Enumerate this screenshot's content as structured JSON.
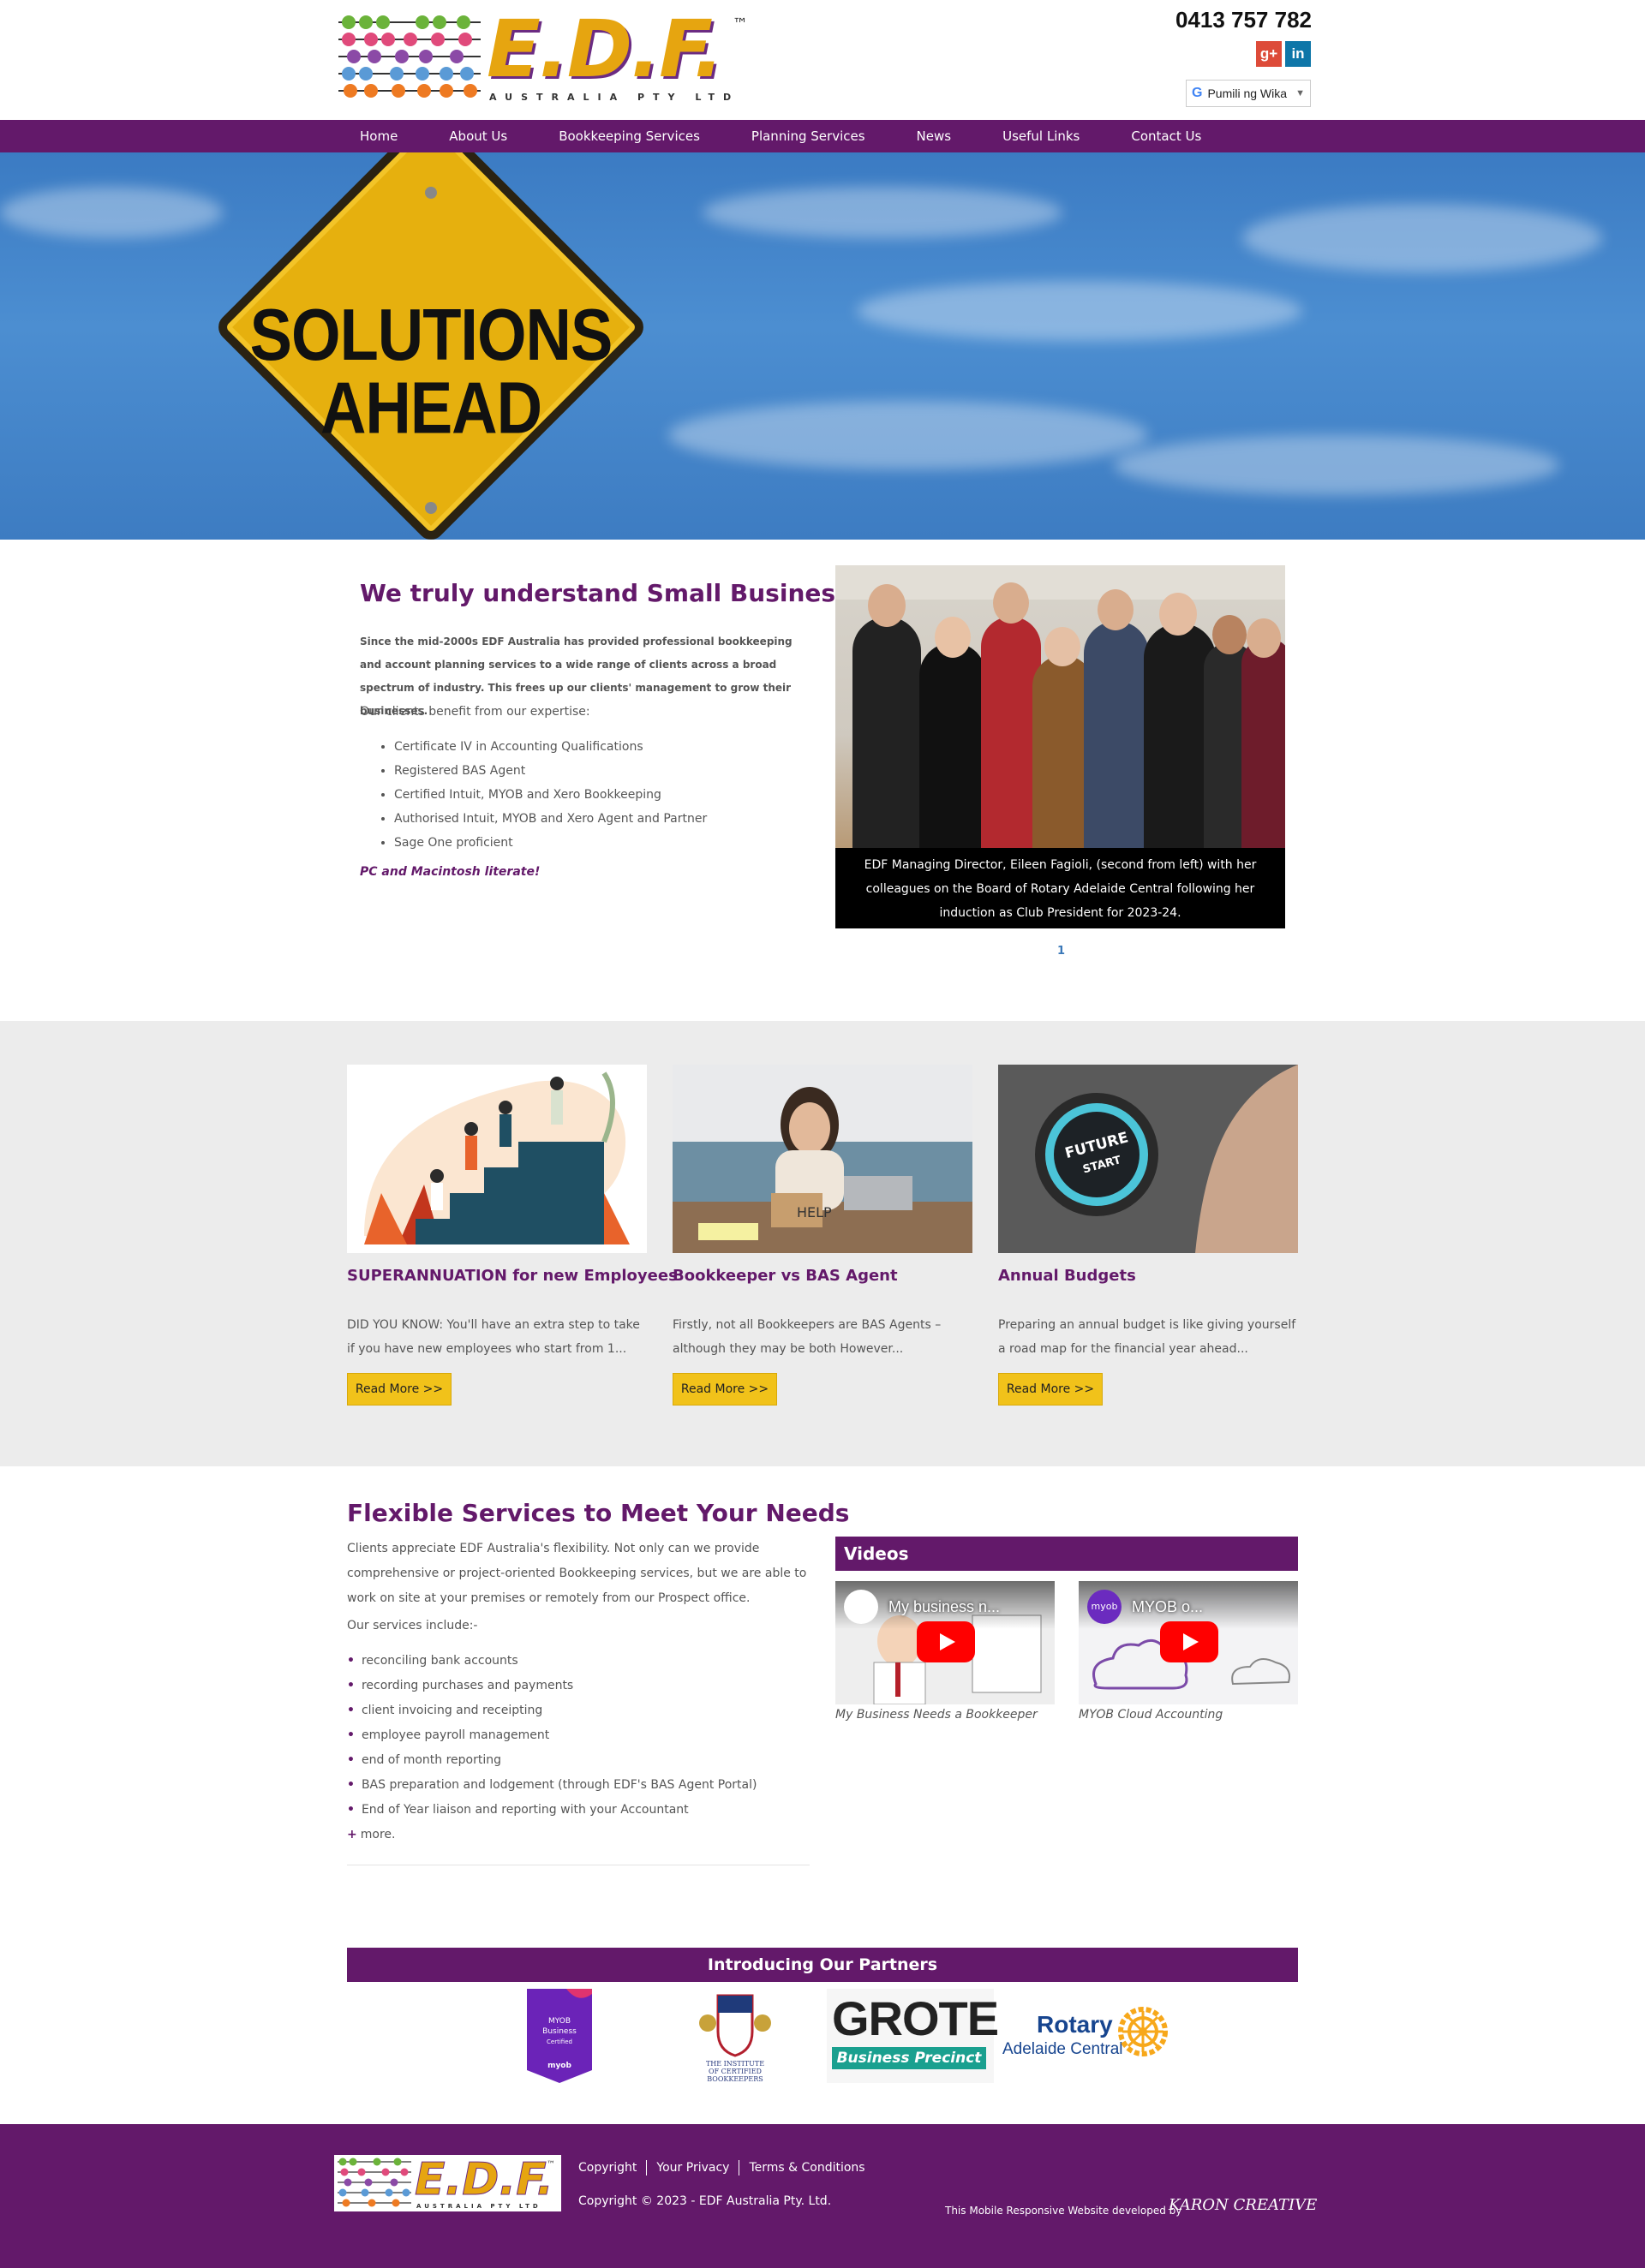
{
  "header": {
    "logo_text": "E.D.F.",
    "logo_tm": "™",
    "logo_sub": "AUSTRALIA PTY LTD",
    "phone": "0413 757 782",
    "social": {
      "gplus": "g+",
      "linkedin": "in"
    },
    "translate": {
      "g": "G",
      "label": "Pumili ng Wika",
      "arrow": "▼"
    }
  },
  "nav": {
    "items": [
      "Home",
      "About Us",
      "Bookkeeping Services",
      "Planning Services",
      "News",
      "Useful Links",
      "Contact Us"
    ]
  },
  "hero": {
    "sign_line1": "SOLUTIONS",
    "sign_line2": "AHEAD"
  },
  "intro": {
    "title": "We truly understand Small Business",
    "bold_text": "Since the mid-2000s EDF Australia has provided professional bookkeeping and account planning services to a wide range of clients across a broad spectrum of industry. This frees up our clients' management to grow their businesses.",
    "lead": "Our clients benefit from our expertise:",
    "list": [
      "Certificate IV in Accounting Qualifications",
      "Registered BAS Agent",
      "Certified Intuit, MYOB and Xero Bookkeeping",
      "Authorised Intuit, MYOB and Xero Agent and Partner",
      "Sage One proficient"
    ],
    "tagline": "PC and Macintosh literate!",
    "caption": "EDF Managing Director, Eileen Fagioli, (second from left) with her colleagues on the Board of Rotary Adelaide Central following her induction as Club President for 2023-24.",
    "pager": "1"
  },
  "cards": [
    {
      "title": "SUPERANNUATION for new Employees",
      "excerpt": "DID YOU KNOW: You'll have an extra step to take if you have new employees who start from 1...",
      "button": "Read More >>"
    },
    {
      "title": "Bookkeeper vs BAS Agent",
      "excerpt": "Firstly, not all Bookkeepers are BAS Agents – although they may be both However...",
      "button": "Read More >>",
      "sign_text": "HELP"
    },
    {
      "title": "Annual Budgets",
      "excerpt": "Preparing an annual budget is like giving yourself a road map for the financial year ahead...",
      "button": "Read More >>",
      "button_text_1": "FUTURE",
      "button_text_2": "START"
    }
  ],
  "services": {
    "title": "Flexible Services to Meet Your Needs",
    "paragraph": "Clients appreciate EDF Australia's flexibility. Not only can we provide comprehensive or project-oriented Bookkeeping services, but we are able to work on site at your premises or remotely from our Prospect office.",
    "lead": "Our services include:-",
    "list": [
      "reconciling bank accounts",
      "recording purchases and payments",
      "client invoicing and receipting",
      "employee payroll management",
      "end of month reporting",
      "BAS preparation and lodgement (through EDF's BAS Agent Portal)",
      "End of Year liaison and reporting with your Accountant"
    ],
    "more_bullet": "+",
    "more": "more."
  },
  "videos": {
    "heading": "Videos",
    "items": [
      {
        "title": "My business n...",
        "caption": "My Business Needs a Bookkeeper"
      },
      {
        "title": "MYOB o...",
        "caption": "MYOB Cloud Accounting",
        "channel": "myob"
      }
    ]
  },
  "partners": {
    "heading": "Introducing Our Partners",
    "myob_line1": "MYOB",
    "myob_line2": "Business",
    "myob_line3": "Certified",
    "myob_brand": "myob",
    "icb_line1": "THE INSTITUTE",
    "icb_line2": "OF CERTIFIED",
    "icb_line3": "BOOKKEEPERS",
    "grote": "GROTE",
    "grote_sub": "Business Precinct",
    "rotary": "Rotary",
    "rotary_sub": "Adelaide Central"
  },
  "footer": {
    "links": [
      "Copyright",
      "Your Privacy",
      "Terms & Conditions"
    ],
    "copyright": "Copyright © 2023 - EDF Australia Pty. Ltd.",
    "developer": "This Mobile Responsive Website developed by",
    "developer_brand": "KARON CREATIVE"
  },
  "colors": {
    "brand_purple": "#63196a",
    "button_yellow": "#f1c21a",
    "logo_gold": "#e6a510"
  }
}
